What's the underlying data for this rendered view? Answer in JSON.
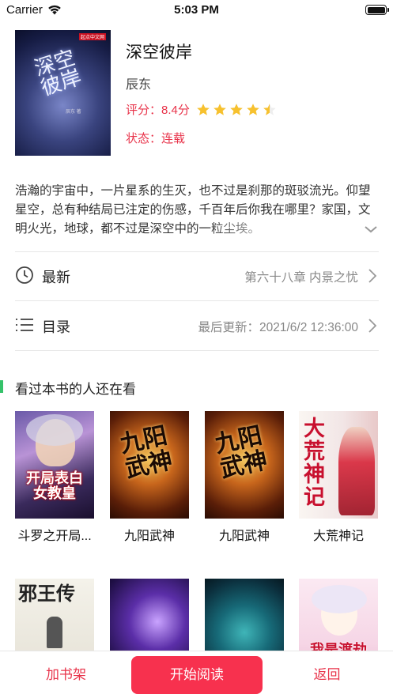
{
  "status_bar": {
    "carrier": "Carrier",
    "time": "5:03 PM"
  },
  "book": {
    "title": "深空彼岸",
    "author": "辰东",
    "score_label": "评分：8.4分",
    "rating_stars": 4.5,
    "status_label": "状态：连载",
    "cover": {
      "title": "深空彼岸",
      "tag": "起点中文网",
      "sub": "辰东 著"
    },
    "intro": "浩瀚的宇宙中，一片星系的生灭，也不过是刹那的斑驳流光。仰望星空，总有种结局已注定的伤感，千百年后你我在哪里？家国，文明火光，地球，都不过是深空中的一粒尘埃。"
  },
  "rows": {
    "latest": {
      "label": "最新",
      "value": "第六十八章 内景之忧"
    },
    "catalog": {
      "label": "目录",
      "value": "最后更新：2021/6/2 12:36:00"
    }
  },
  "recommend": {
    "title": "看过本书的人还在看",
    "items": [
      {
        "label": "斗罗之开局...",
        "cover_text": "开局表白女教皇"
      },
      {
        "label": "九阳武神",
        "cover_text": "九阳武神"
      },
      {
        "label": "九阳武神",
        "cover_text": "九阳武神"
      },
      {
        "label": "大荒神记",
        "cover_text": "大荒神记"
      },
      {
        "label": "",
        "cover_text": "邪王传"
      },
      {
        "label": "",
        "cover_text": ""
      },
      {
        "label": "",
        "cover_text": ""
      },
      {
        "label": "",
        "cover_text": "我是渡劫"
      }
    ]
  },
  "bottom": {
    "add_shelf": "加书架",
    "start_read": "开始阅读",
    "back": "返回"
  },
  "colors": {
    "accent": "#f7314e",
    "accent_text": "#e8334a",
    "star": "#f7c12e",
    "section_bar": "#35c26a"
  }
}
